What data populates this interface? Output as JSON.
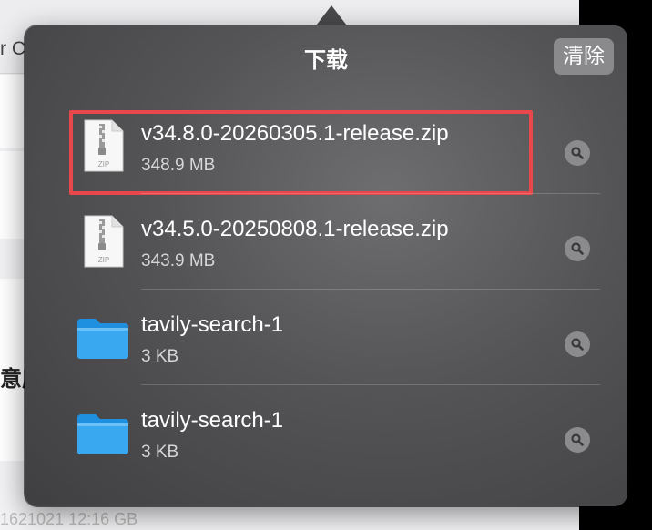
{
  "background": {
    "toolbar_text": "r C",
    "side_text": "意度",
    "bottom_text": "1621021 12:16 GB"
  },
  "popover": {
    "title": "下载",
    "clear_label": "清除"
  },
  "downloads": [
    {
      "name": "v34.8.0-20260305.1-release.zip",
      "size": "348.9 MB",
      "icon": "zip-file-icon",
      "highlighted": true
    },
    {
      "name": "v34.5.0-20250808.1-release.zip",
      "size": "343.9 MB",
      "icon": "zip-file-icon",
      "highlighted": false
    },
    {
      "name": "tavily-search-1",
      "size": "3 KB",
      "icon": "folder-icon",
      "highlighted": false
    },
    {
      "name": "tavily-search-1",
      "size": "3 KB",
      "icon": "folder-icon",
      "highlighted": false
    }
  ],
  "colors": {
    "highlight": "#e8484b",
    "folder": "#3aa8f0"
  }
}
